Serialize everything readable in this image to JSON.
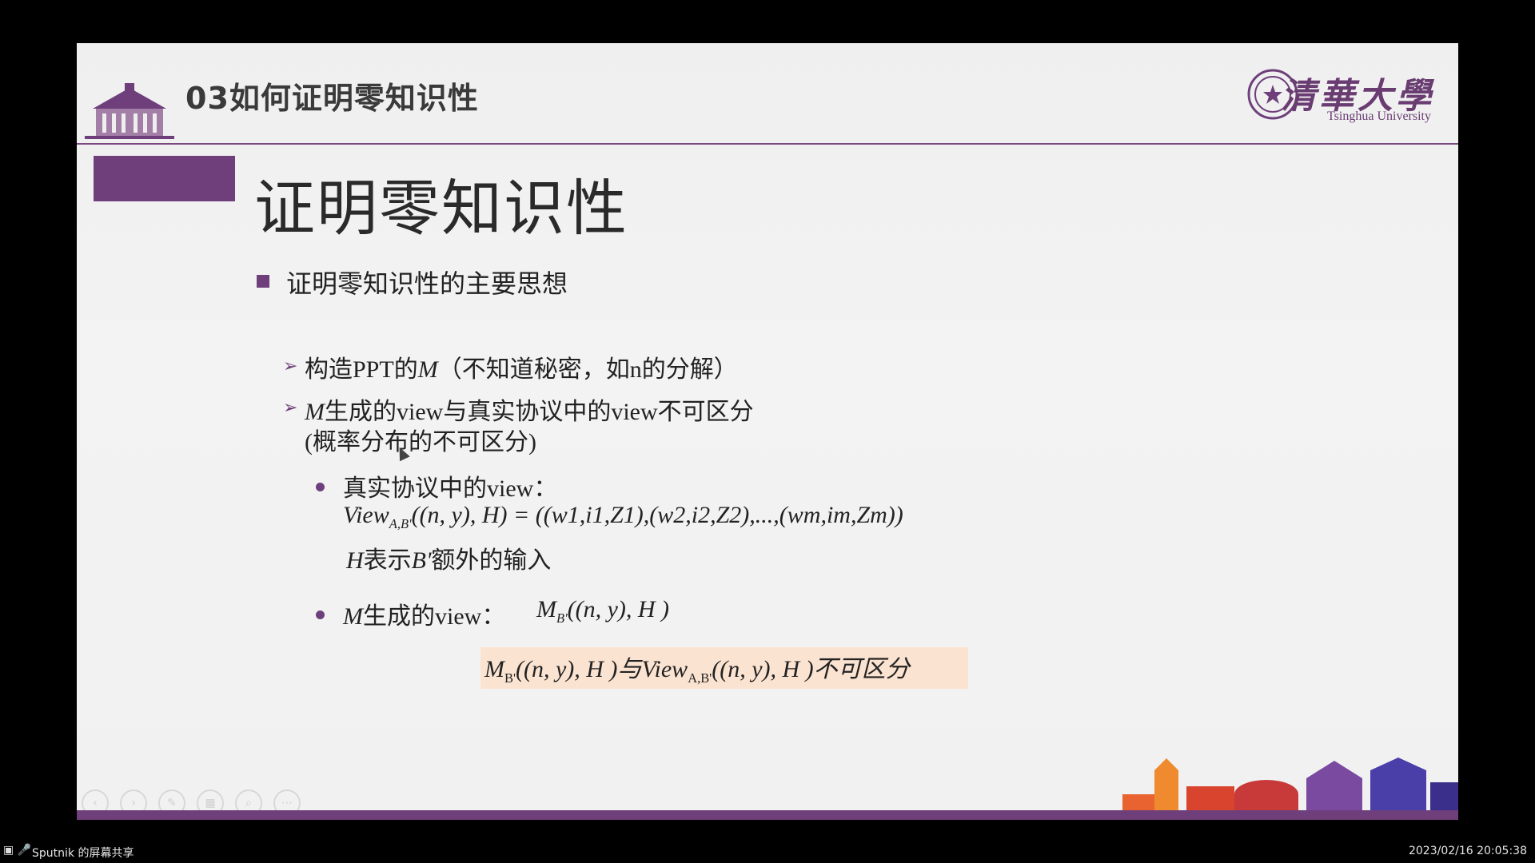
{
  "slide": {
    "header_title": "03如何证明零知识性",
    "university_cn": "清華大學",
    "university_en": "Tsinghua University",
    "title": "证明零知识性",
    "bullet1": "证明零知识性的主要思想",
    "sub1_prefix": "构造PPT的",
    "sub1_var": "M",
    "sub1_suffix": "（不知道秘密，如n的分解）",
    "sub2_var": "M",
    "sub2_text": "生成的view与真实协议中的view不可区分",
    "sub2_line2": "(概率分布的不可区分)",
    "real_view_label": "真实协议中的view：",
    "formula_view": "View",
    "formula_view_sub": "A,B'",
    "formula_view_rest": "((n, y), H) = ((w",
    "formula_terms": "1,i1,Z1),(w2,i2,Z2),...,(wm,im,Zm))",
    "h_var": "H",
    "h_desc_1": "表示",
    "h_desc_var": "B'",
    "h_desc_2": "额外的输入",
    "m_view_var": "M",
    "m_view_label": "生成的view：",
    "m_formula": "M",
    "m_formula_sub": "B'",
    "m_formula_rest": "((n, y), H )",
    "conclusion_m": "M",
    "conclusion_m_sub": "B'",
    "conclusion_mid": "((n, y), H )与",
    "conclusion_view": "View",
    "conclusion_view_sub": "A,B'",
    "conclusion_end": "((n, y), H )不可区分"
  },
  "taskbar": {
    "share_label": "Sputnik 的屏幕共享",
    "clock": "2023/02/16 20:05:38"
  },
  "colors": {
    "accent": "#6e3f7a",
    "highlight": "#fbe3d1"
  }
}
